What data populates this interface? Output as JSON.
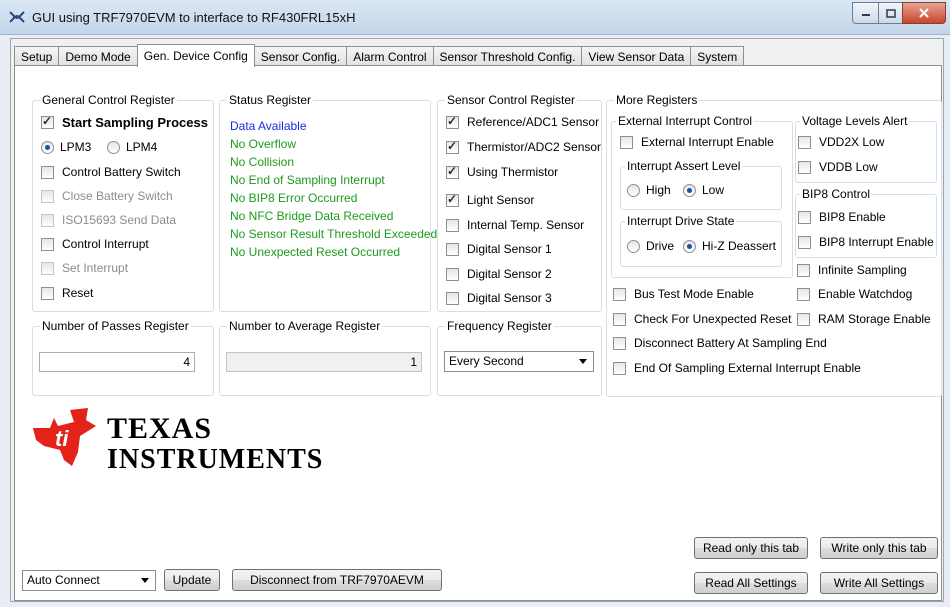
{
  "window": {
    "title": "GUI using TRF7970EVM to interface to RF430FRL15xH"
  },
  "tabs": [
    "Setup",
    "Demo Mode",
    "Gen. Device Config",
    "Sensor Config.",
    "Alarm Control",
    "Sensor Threshold Config.",
    "View Sensor Data",
    "System"
  ],
  "general_control": {
    "title": "General Control Register",
    "start_sampling": "Start Sampling Process",
    "lpm3": "LPM3",
    "lpm4": "LPM4",
    "control_battery_switch": "Control Battery Switch",
    "close_battery_switch": "Close Battery Switch",
    "iso15693_send_data": "ISO15693 Send Data",
    "control_interrupt": "Control Interrupt",
    "set_interrupt": "Set Interrupt",
    "reset": "Reset"
  },
  "status_register": {
    "title": "Status Register",
    "lines": [
      "Data Available",
      "No Overflow",
      "No Collision",
      "No End of Sampling Interrupt",
      "No BIP8 Error Occurred",
      "No NFC Bridge Data Received",
      "No Sensor Result Threshold Exceeded",
      "No Unexpected Reset Occurred"
    ]
  },
  "sensor_control": {
    "title": "Sensor Control Register",
    "items": [
      "Reference/ADC1 Sensor",
      "Thermistor/ADC2 Sensor",
      "Using Thermistor",
      "Light Sensor",
      "Internal Temp. Sensor",
      "Digital Sensor 1",
      "Digital Sensor 2",
      "Digital Sensor 3"
    ]
  },
  "more_registers": {
    "title": "More Registers",
    "ext_int_control": {
      "title": "External Interrupt Control",
      "enable": "External Interrupt Enable",
      "assert_level": {
        "title": "Interrupt Assert Level",
        "high": "High",
        "low": "Low"
      },
      "drive_state": {
        "title": "Interrupt Drive State",
        "drive": "Drive",
        "hiz": "Hi-Z Deassert"
      }
    },
    "voltage_alert": {
      "title": "Voltage Levels Alert",
      "vdd2x": "VDD2X Low",
      "vddb": "VDDB Low"
    },
    "bip8": {
      "title": "BIP8 Control",
      "enable": "BIP8 Enable",
      "interrupt_enable": "BIP8 Interrupt Enable"
    },
    "infinite_sampling": "Infinite Sampling",
    "enable_watchdog": "Enable Watchdog",
    "ram_storage_enable": "RAM Storage Enable",
    "bus_test_mode": "Bus Test Mode Enable",
    "check_unexpected_reset": "Check For Unexpected Reset",
    "disconnect_battery": "Disconnect Battery At Sampling End",
    "end_of_sampling_ext_int": "End Of Sampling External Interrupt Enable"
  },
  "passes": {
    "title": "Number of Passes Register",
    "value": "4"
  },
  "average": {
    "title": "Number to Average Register",
    "value": "1"
  },
  "frequency": {
    "title": "Frequency Register",
    "value": "Every Second"
  },
  "logo": {
    "line1": "TEXAS",
    "line2": "INSTRUMENTS"
  },
  "buttons": {
    "read_tab": "Read only this tab",
    "write_tab": "Write only this tab",
    "read_all": "Read All Settings",
    "write_all": "Write All Settings",
    "update": "Update",
    "disconnect": "Disconnect from TRF7970AEVM"
  },
  "connect_mode": "Auto Connect",
  "colors": {
    "status_blue": "#1a2de0",
    "status_green": "#1e9a1e",
    "ti_red": "#e2231a"
  }
}
